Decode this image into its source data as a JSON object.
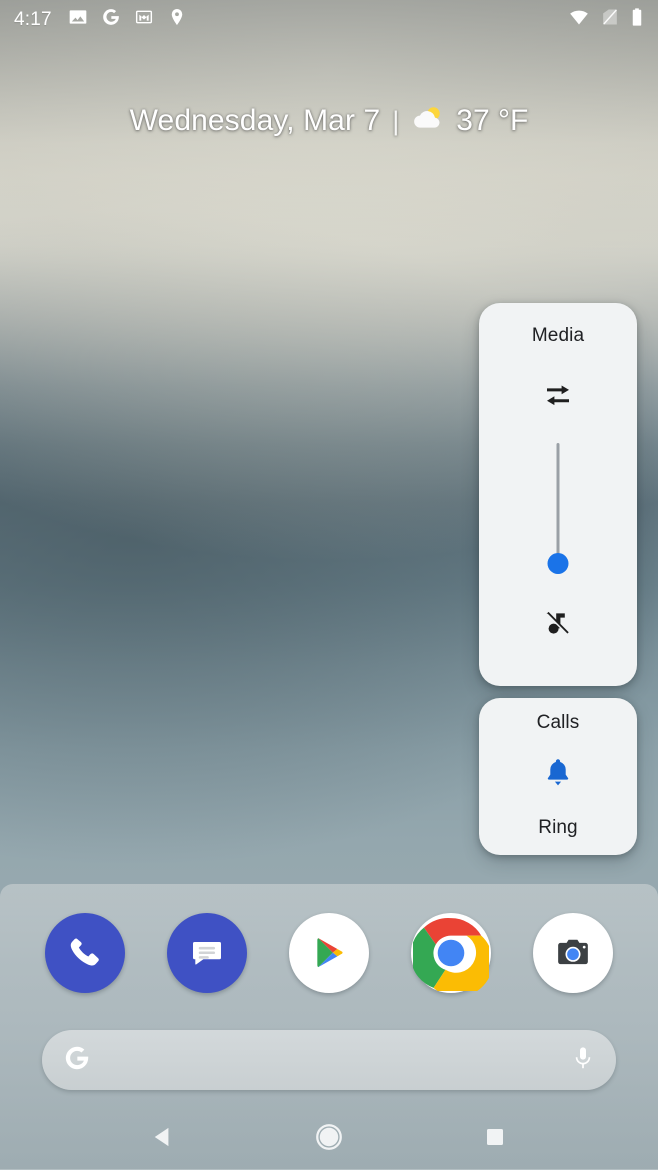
{
  "status_bar": {
    "time": "4:17",
    "notification_icons": [
      {
        "name": "photos-icon",
        "label": "Photos"
      },
      {
        "name": "google-icon",
        "label": "Google"
      },
      {
        "name": "gmail-icon",
        "label": "Gmail"
      },
      {
        "name": "location-pin-icon",
        "label": "Location"
      }
    ],
    "system_icons": [
      {
        "name": "wifi-icon",
        "label": "Wi-Fi"
      },
      {
        "name": "no-sim-icon",
        "label": "No SIM"
      },
      {
        "name": "battery-icon",
        "label": "Battery full"
      }
    ]
  },
  "date_widget": {
    "date": "Wednesday, Mar 7",
    "separator": "|",
    "temperature": "37 °F",
    "weather_icon": "partly-cloudy-icon"
  },
  "volume_panels": {
    "media": {
      "title": "Media",
      "output_switch_icon": "output-switch-icon",
      "slider": {
        "name": "media-volume-slider",
        "orientation": "vertical",
        "value": 0,
        "min": 0,
        "max": 100
      },
      "state_icon": "music-note-off-icon"
    },
    "calls": {
      "title": "Calls",
      "mode_icon": "bell-ring-icon",
      "mode_label": "Ring"
    }
  },
  "dock": {
    "apps": [
      {
        "name": "phone-app-icon",
        "label": "Phone"
      },
      {
        "name": "messages-app-icon",
        "label": "Messages"
      },
      {
        "name": "play-store-app-icon",
        "label": "Play Store"
      },
      {
        "name": "chrome-app-icon",
        "label": "Chrome"
      },
      {
        "name": "camera-app-icon",
        "label": "Camera"
      }
    ]
  },
  "search": {
    "value": "",
    "placeholder": "",
    "logo_icon": "google-g-icon",
    "voice_icon": "microphone-icon"
  },
  "nav_bar": {
    "back": "back-button",
    "home": "home-button",
    "recents": "recents-button"
  },
  "colors": {
    "accent_blue": "#1a73e8",
    "bell_blue": "#1967d2",
    "panel_bg": "#f1f3f4",
    "panel_text": "#202124",
    "slider_track": "#9aa0a6"
  }
}
